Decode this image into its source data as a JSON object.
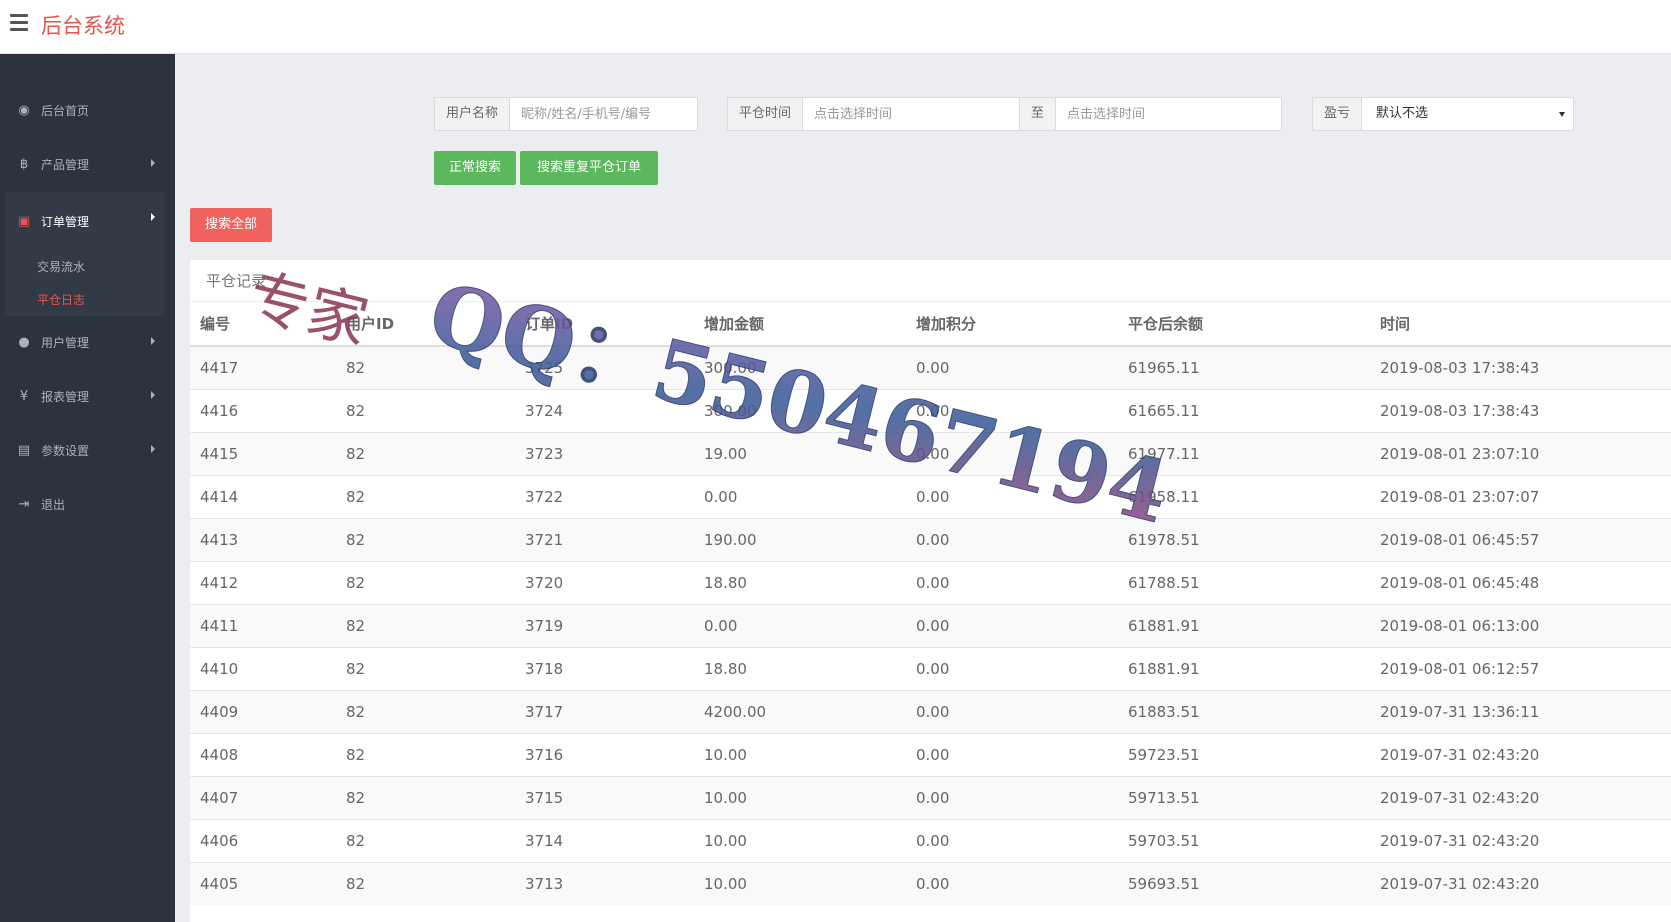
{
  "header": {
    "title": "后台系统"
  },
  "sidebar": {
    "items": [
      {
        "label": "后台首页",
        "icon": "dashboard-icon"
      },
      {
        "label": "产品管理",
        "icon": "bitcoin-icon"
      },
      {
        "label": "订单管理",
        "icon": "orders-icon"
      },
      {
        "label": "用户管理",
        "icon": "user-icon"
      },
      {
        "label": "报表管理",
        "icon": "yen-icon"
      },
      {
        "label": "参数设置",
        "icon": "settings-icon"
      },
      {
        "label": "退出",
        "icon": "logout-icon"
      }
    ],
    "sub_items": [
      {
        "label": "交易流水"
      },
      {
        "label": "平仓日志"
      }
    ]
  },
  "filters": {
    "username_label": "用户名称",
    "username_placeholder": "昵称/姓名/手机号/编号",
    "time_label": "平仓时间",
    "time_start_placeholder": "点击选择时间",
    "time_sep": "至",
    "time_end_placeholder": "点击选择时间",
    "profit_label": "盈亏",
    "profit_selected": "默认不选",
    "search_button": "正常搜索",
    "dup_button": "搜索重复平仓订单",
    "search_all_button": "搜索全部"
  },
  "panel": {
    "title": "平仓记录",
    "columns": [
      "编号",
      "用户ID",
      "订单ID",
      "增加金额",
      "增加积分",
      "平仓后余额",
      "时间"
    ],
    "rows": [
      [
        "4417",
        "82",
        "3725",
        "300.00",
        "0.00",
        "61965.11",
        "2019-08-03 17:38:43"
      ],
      [
        "4416",
        "82",
        "3724",
        "300.00",
        "0.00",
        "61665.11",
        "2019-08-03 17:38:43"
      ],
      [
        "4415",
        "82",
        "3723",
        "19.00",
        "0.00",
        "61977.11",
        "2019-08-01 23:07:10"
      ],
      [
        "4414",
        "82",
        "3722",
        "0.00",
        "0.00",
        "61958.11",
        "2019-08-01 23:07:07"
      ],
      [
        "4413",
        "82",
        "3721",
        "190.00",
        "0.00",
        "61978.51",
        "2019-08-01 06:45:57"
      ],
      [
        "4412",
        "82",
        "3720",
        "18.80",
        "0.00",
        "61788.51",
        "2019-08-01 06:45:48"
      ],
      [
        "4411",
        "82",
        "3719",
        "0.00",
        "0.00",
        "61881.91",
        "2019-08-01 06:13:00"
      ],
      [
        "4410",
        "82",
        "3718",
        "18.80",
        "0.00",
        "61881.91",
        "2019-08-01 06:12:57"
      ],
      [
        "4409",
        "82",
        "3717",
        "4200.00",
        "0.00",
        "61883.51",
        "2019-07-31 13:36:11"
      ],
      [
        "4408",
        "82",
        "3716",
        "10.00",
        "0.00",
        "59723.51",
        "2019-07-31 02:43:20"
      ],
      [
        "4407",
        "82",
        "3715",
        "10.00",
        "0.00",
        "59713.51",
        "2019-07-31 02:43:20"
      ],
      [
        "4406",
        "82",
        "3714",
        "10.00",
        "0.00",
        "59703.51",
        "2019-07-31 02:43:20"
      ],
      [
        "4405",
        "82",
        "3713",
        "10.00",
        "0.00",
        "59693.51",
        "2019-07-31 02:43:20"
      ]
    ]
  },
  "watermark": {
    "text1": "专家",
    "text2": "QQ：550467194"
  },
  "colors": {
    "brand": "#e5554f",
    "sidebar_bg": "#2b333e",
    "green": "#5cb85c",
    "red": "#f0625d"
  }
}
